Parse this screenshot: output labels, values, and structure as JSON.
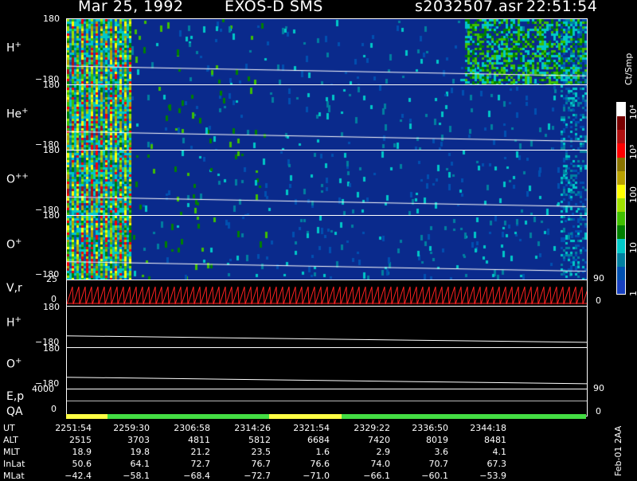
{
  "header": {
    "date": "Mar 25, 1992",
    "instrument": "EXOS-D SMS",
    "file": "s2032507.asr",
    "time": "22:51:54"
  },
  "panels": [
    {
      "label": "H",
      "sup": "+",
      "ymax": "180",
      "ymin": "-180"
    },
    {
      "label": "He",
      "sup": "+",
      "ymax": "180",
      "ymin": "-180"
    },
    {
      "label": "O",
      "sup": "++",
      "ymax": "180",
      "ymin": "-180"
    },
    {
      "label": "O",
      "sup": "+",
      "ymax": "180",
      "ymin": "-180"
    }
  ],
  "vr": {
    "label": "V,r",
    "ytop": "25",
    "ybot": "0",
    "right_top": "90",
    "right_bot": "0"
  },
  "lower": [
    {
      "label": "H",
      "sup": "+",
      "ymax": "180",
      "ymin": "-180"
    },
    {
      "label": "O",
      "sup": "+",
      "ymax": "180",
      "ymin": "-180"
    }
  ],
  "ep": {
    "label": "E,p",
    "value": "4000",
    "right": "90"
  },
  "qa": {
    "label": "QA",
    "value": "0",
    "right": "0"
  },
  "colorbar": {
    "unit": "Ct/Smp",
    "ticks": [
      "10",
      "10",
      "100",
      "10",
      "1"
    ],
    "tick_sup": [
      "4",
      "",
      "",
      "3",
      ""
    ],
    "tick_labels_render": [
      "10⁴",
      "10³",
      "100",
      "10",
      "1"
    ],
    "colors": [
      "#ffffff",
      "#7a0000",
      "#b01010",
      "#ff0000",
      "#8a7400",
      "#b8a000",
      "#ffff00",
      "#a0e000",
      "#40c000",
      "#008000",
      "#00c8c8",
      "#0080a0",
      "#0050b0",
      "#1840c0"
    ]
  },
  "ephemeris": {
    "rows": [
      {
        "name": "UT",
        "values": [
          "2251:54",
          "2259:30",
          "2306:58",
          "2314:26",
          "2321:54",
          "2329:22",
          "2336:50",
          "2344:18"
        ]
      },
      {
        "name": "ALT",
        "values": [
          "2515",
          "3703",
          "4811",
          "5812",
          "6684",
          "7420",
          "8019",
          "8481"
        ]
      },
      {
        "name": "MLT",
        "values": [
          "18.9",
          "19.8",
          "21.2",
          "23.5",
          "1.6",
          "2.9",
          "3.6",
          "4.1"
        ]
      },
      {
        "name": "InLat",
        "values": [
          "50.6",
          "64.1",
          "72.7",
          "76.7",
          "76.6",
          "74.0",
          "70.7",
          "67.3"
        ]
      },
      {
        "name": "MLat",
        "values": [
          "-42.4",
          "-58.1",
          "-68.4",
          "-72.7",
          "-71.0",
          "-66.1",
          "-60.1",
          "-53.9"
        ]
      }
    ]
  },
  "footer_stamp": "Feb-01 2AA",
  "qa_segments": [
    {
      "color": "#ffff44",
      "frac": 0.08
    },
    {
      "color": "#44dd44",
      "frac": 0.31
    },
    {
      "color": "#ffff44",
      "frac": 0.14
    },
    {
      "color": "#44dd44",
      "frac": 0.47
    }
  ]
}
